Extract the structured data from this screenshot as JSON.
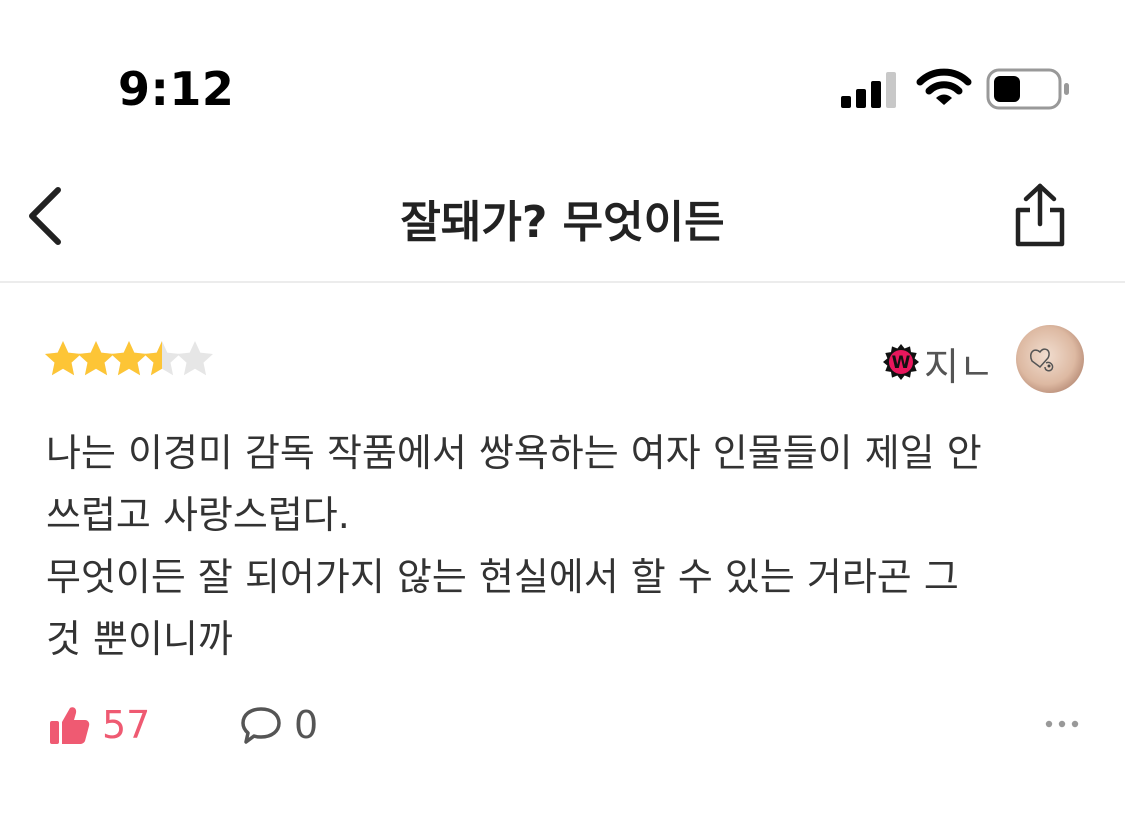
{
  "status_bar": {
    "time": "9:12"
  },
  "header": {
    "title": "잘돼가? 무엇이든"
  },
  "review": {
    "rating": 3.5,
    "rating_max": 5,
    "user": {
      "badge": "W",
      "name": "지ㄴ"
    },
    "body_lines": [
      "나는 이경미 감독 작품에서 쌍욕하는 여자 인물들이 제일 안",
      "쓰럽고 사랑스럽다.",
      "무엇이든 잘 되어가지 않는 현실에서 할 수 있는 거라곤 그",
      "것 뿐이니까"
    ],
    "likes": "57",
    "comments": "0"
  },
  "colors": {
    "star": "#FDC536",
    "star_empty": "#E6E6E6",
    "like": "#EF5A72",
    "badge": "#E8175D"
  },
  "icons": [
    "back-chevron-icon",
    "share-icon",
    "thumbs-up-icon",
    "comment-bubble-icon",
    "more-dots-icon"
  ]
}
